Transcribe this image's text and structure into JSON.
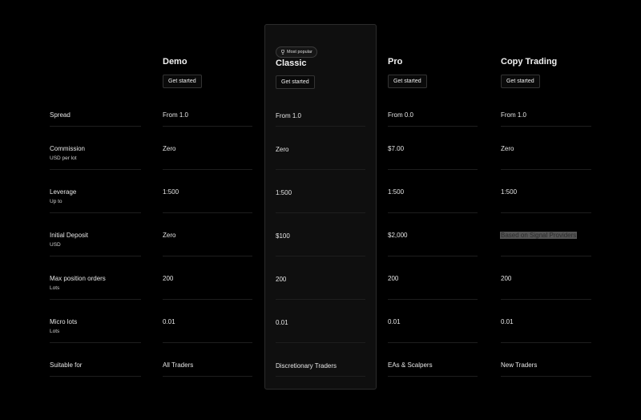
{
  "plans": [
    {
      "name": "Demo",
      "button": "Get started"
    },
    {
      "name": "Classic",
      "button": "Get started",
      "badge": "Most popular"
    },
    {
      "name": "Pro",
      "button": "Get started"
    },
    {
      "name": "Copy Trading",
      "button": "Get started"
    }
  ],
  "rows": [
    {
      "label": "Spread",
      "sub": "",
      "values": [
        "From 1.0",
        "From 1.0",
        "From 0.0",
        "From 1.0"
      ]
    },
    {
      "label": "Commission",
      "sub": "USD per lot",
      "values": [
        "Zero",
        "Zero",
        "$7.00",
        "Zero"
      ]
    },
    {
      "label": "Leverage",
      "sub": "Up to",
      "values": [
        "1:500",
        "1:500",
        "1:500",
        "1:500"
      ]
    },
    {
      "label": "Initial Deposit",
      "sub": "USD",
      "values": [
        "Zero",
        "$100",
        "$2,000",
        "Based on Signal Providers"
      ]
    },
    {
      "label": "Max position orders",
      "sub": "Lots",
      "values": [
        "200",
        "200",
        "200",
        "200"
      ]
    },
    {
      "label": "Micro lots",
      "sub": "Lots",
      "values": [
        "0.01",
        "0.01",
        "0.01",
        "0.01"
      ]
    },
    {
      "label": "Suitable for",
      "sub": "",
      "values": [
        "All Traders",
        "Discretionary Traders",
        "EAs & Scalpers",
        "New Traders"
      ]
    }
  ],
  "colors": {
    "background": "#000000",
    "highlight_column": "#0f0f0f",
    "text": "#e6e6e6",
    "selection": "#555555"
  },
  "icons": {
    "badge": "trophy-icon"
  }
}
